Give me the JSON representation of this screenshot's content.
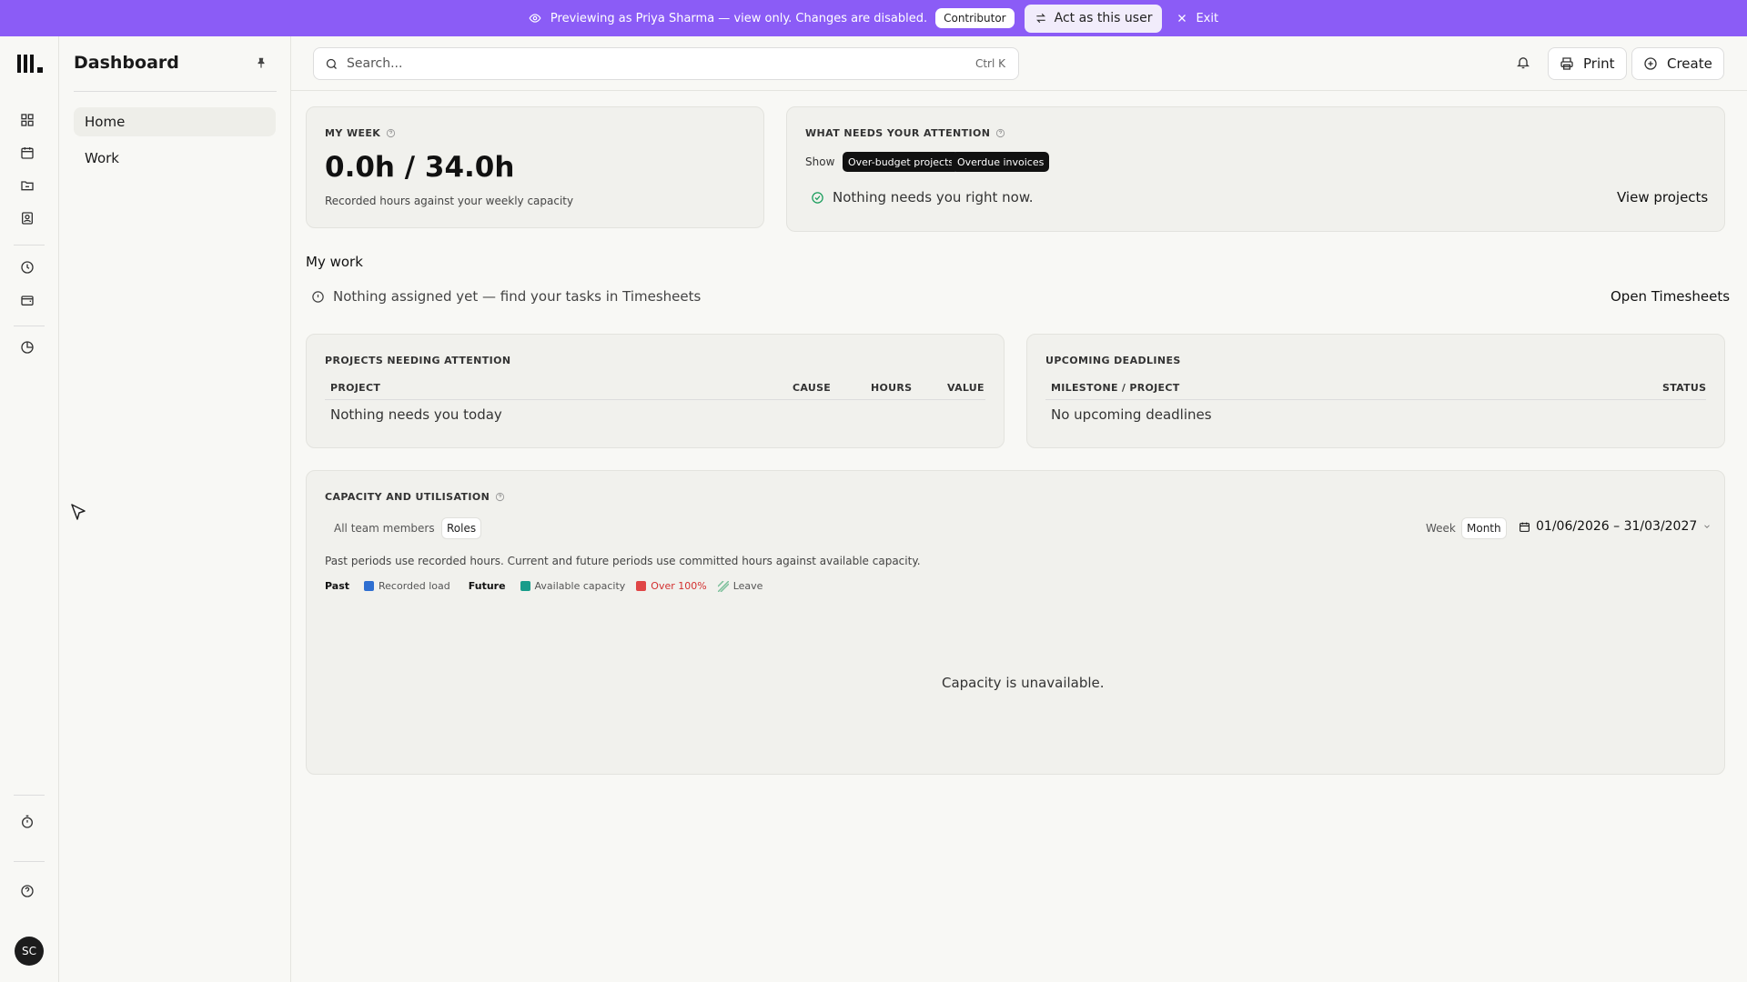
{
  "banner": {
    "message": "Previewing as Priya Sharma — view only. Changes are disabled.",
    "role_tag": "Contributor",
    "act_button": "Act as this user",
    "exit_label": "Exit"
  },
  "sidebar": {
    "title": "Dashboard",
    "items": [
      {
        "label": "Home"
      },
      {
        "label": "Work"
      }
    ]
  },
  "user": {
    "initials": "SC"
  },
  "topbar": {
    "search_placeholder": "Search...",
    "search_shortcut": "Ctrl K",
    "print_label": "Print",
    "create_label": "Create"
  },
  "my_week": {
    "title": "MY WEEK",
    "value": "0.0h / 34.0h",
    "subtitle": "Recorded hours against your weekly capacity"
  },
  "attention": {
    "title": "WHAT NEEDS YOUR ATTENTION",
    "show_label": "Show",
    "chips": [
      "Over-budget projects",
      "Overdue invoices"
    ],
    "empty_text": "Nothing needs you right now.",
    "link": "View projects"
  },
  "my_work": {
    "title": "My work",
    "empty_text": "Nothing assigned yet — find your tasks in Timesheets",
    "link": "Open Timesheets"
  },
  "projects_attention": {
    "title": "PROJECTS NEEDING ATTENTION",
    "columns": [
      "PROJECT",
      "CAUSE",
      "HOURS",
      "VALUE"
    ],
    "empty_text": "Nothing needs you today"
  },
  "deadlines": {
    "title": "UPCOMING DEADLINES",
    "columns": [
      "MILESTONE / PROJECT",
      "STATUS"
    ],
    "empty_text": "No upcoming deadlines"
  },
  "capacity": {
    "title": "CAPACITY AND UTILISATION",
    "scope_tabs": [
      "All team members",
      "Roles"
    ],
    "period_tabs": [
      "Week",
      "Month"
    ],
    "date_range": "01/06/2026 – 31/03/2027",
    "description": "Past periods use recorded hours. Current and future periods use committed hours against available capacity.",
    "legend": {
      "past_label": "Past",
      "recorded": "Recorded load",
      "future_label": "Future",
      "available": "Available capacity",
      "over": "Over 100%",
      "leave": "Leave"
    },
    "empty_text": "Capacity is unavailable.",
    "colors": {
      "recorded": "#2f6fd1",
      "available": "#179c8a",
      "over": "#e04646",
      "over_text": "#d32f2f"
    }
  }
}
